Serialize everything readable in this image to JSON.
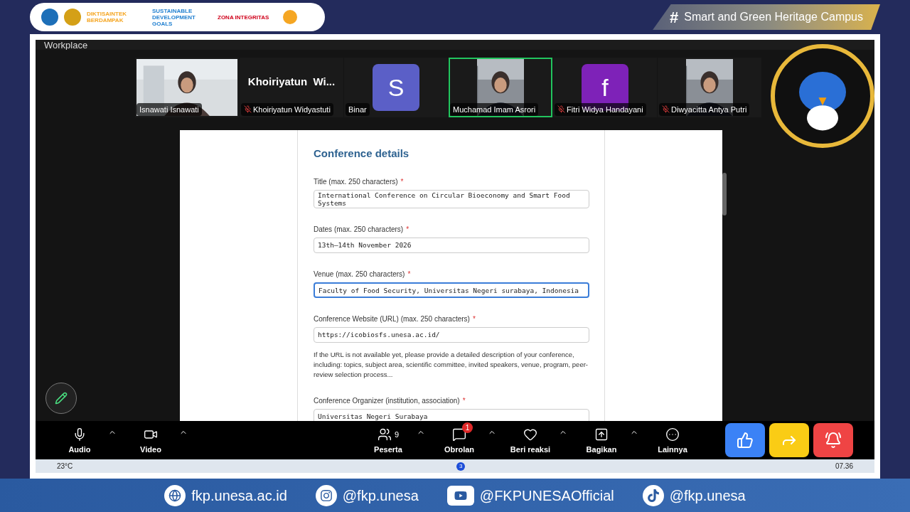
{
  "header": {
    "logos": [
      "DIKTISAINTEK BERDAMPAK",
      "SUSTAINABLE DEVELOPMENT GOALS",
      "ZONA INTEGRITAS"
    ],
    "tagline_symbol": "#",
    "tagline": "Smart and Green Heritage Campus"
  },
  "meeting": {
    "window_title": "Workplace",
    "participants": [
      {
        "kind": "video",
        "name": "Isnawati Isnawati",
        "muted": false,
        "speaking": false
      },
      {
        "kind": "name",
        "display": "Khoiriyatun  Wi...",
        "name": "Khoiriyatun Widyastuti",
        "muted": true,
        "speaking": false
      },
      {
        "kind": "avatar",
        "initial": "S",
        "name": "Binar",
        "color": "#5b5fc7",
        "muted": false,
        "speaking": false
      },
      {
        "kind": "video",
        "name": "Muchamad Imam Asrori",
        "muted": false,
        "speaking": true
      },
      {
        "kind": "avatar",
        "initial": "f",
        "name": "Fitri Widya Handayani",
        "color": "#7e22b8",
        "muted": true,
        "speaking": false
      },
      {
        "kind": "video",
        "name": "Diwyacitta Antya Putri",
        "muted": true,
        "speaking": false
      }
    ],
    "form": {
      "heading": "Conference details",
      "fields": [
        {
          "label": "Title (max. 250 characters)",
          "required_mark": "*",
          "kind": "textarea",
          "value": "International Conference on Circular Bioeconomy and Smart Food Systems",
          "focused": false
        },
        {
          "label": "Dates (max. 250 characters)",
          "required_mark": "*",
          "kind": "input",
          "value": "13th–14th November 2026",
          "focused": false
        },
        {
          "label": "Venue (max. 250 characters)",
          "required_mark": "*",
          "kind": "input",
          "value": "Faculty of Food Security, Universitas Negeri surabaya, Indonesia",
          "focused": true
        },
        {
          "label": "Conference Website (URL) (max. 250 characters)",
          "required_mark": "*",
          "kind": "input",
          "value": "https://icobiosfs.unesa.ac.id/",
          "focused": false,
          "help": "If the URL is not available yet, please provide a detailed description of your conference, including: topics, subject area, scientific committee, invited speakers, venue, program, peer-review selection process..."
        },
        {
          "label": "Conference Organizer (institution, association)",
          "required_mark": "*",
          "kind": "input",
          "value": "Universitas Negeri Surabaya",
          "focused": false
        }
      ]
    },
    "toolbar_left": [
      {
        "kind": "mic",
        "label": "Audio",
        "caret": true
      },
      {
        "kind": "video",
        "label": "Video",
        "caret": true
      }
    ],
    "toolbar_center": [
      {
        "kind": "people",
        "label": "Peserta",
        "count": "9",
        "caret": true
      },
      {
        "kind": "chat",
        "label": "Obrolan",
        "badge": "1",
        "caret": true
      },
      {
        "kind": "heart",
        "label": "Beri reaksi",
        "caret": true
      },
      {
        "kind": "share",
        "label": "Bagikan",
        "caret": true
      },
      {
        "kind": "more",
        "label": "Lainnya",
        "caret": false
      }
    ],
    "reactions": [
      {
        "kind": "like"
      },
      {
        "kind": "forward"
      },
      {
        "kind": "alarm"
      }
    ],
    "taskbar": {
      "weather": "23°C",
      "badge": "3",
      "time": "07.36"
    }
  },
  "footer": [
    {
      "kind": "globe",
      "text": "fkp.unesa.ac.id"
    },
    {
      "kind": "instagram",
      "text": "@fkp.unesa"
    },
    {
      "kind": "youtube",
      "text": "@FKPUNESAOfficial"
    },
    {
      "kind": "tiktok",
      "text": "@fkp.unesa"
    }
  ]
}
